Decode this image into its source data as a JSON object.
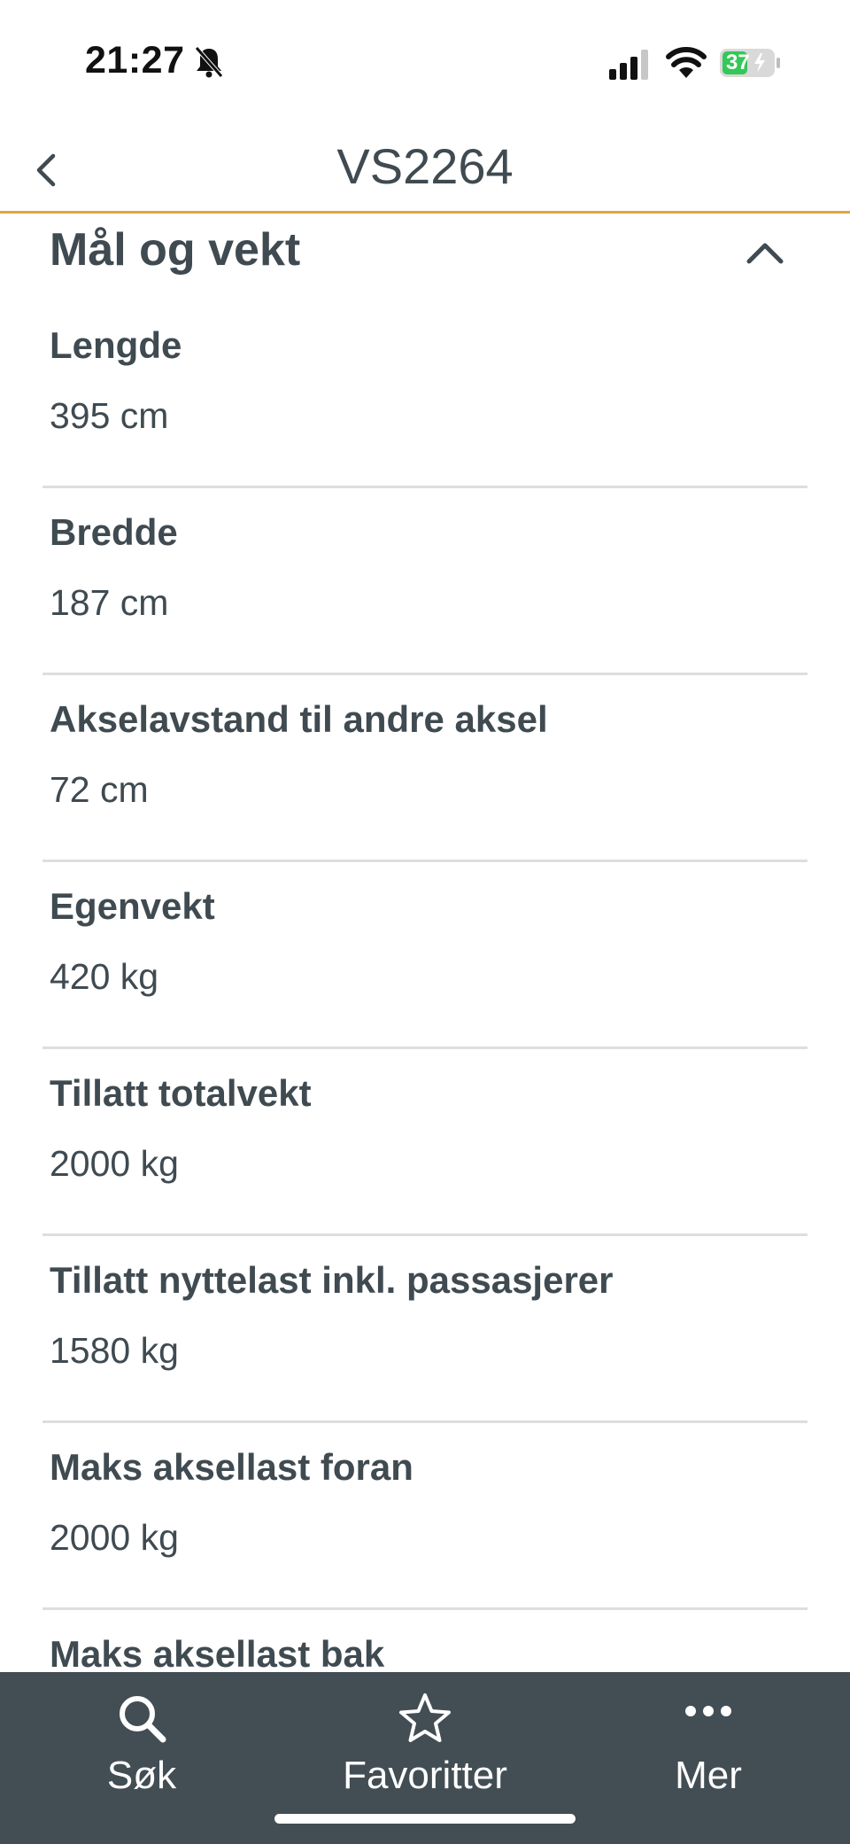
{
  "status_bar": {
    "time": "21:27",
    "battery_level": "37"
  },
  "header": {
    "title": "VS2264",
    "back_icon": "chevron-left-icon"
  },
  "section": {
    "title": "Mål og vekt",
    "toggle_icon": "chevron-up-icon"
  },
  "items": [
    {
      "label": "Lengde",
      "value": "395 cm"
    },
    {
      "label": "Bredde",
      "value": "187 cm"
    },
    {
      "label": "Akselavstand til andre aksel",
      "value": "72 cm"
    },
    {
      "label": "Egenvekt",
      "value": "420 kg"
    },
    {
      "label": "Tillatt totalvekt",
      "value": "2000 kg"
    },
    {
      "label": "Tillatt nyttelast inkl. passasjerer",
      "value": "1580 kg"
    },
    {
      "label": "Maks aksellast foran",
      "value": "2000 kg"
    },
    {
      "label": "Maks aksellast bak",
      "value": ""
    }
  ],
  "tabs": [
    {
      "label": "Søk",
      "icon": "search-icon"
    },
    {
      "label": "Favoritter",
      "icon": "star-icon"
    },
    {
      "label": "Mer",
      "icon": "more-icon"
    }
  ],
  "colors": {
    "accent_rule": "#e0a444",
    "text": "#3f4a51",
    "tab_bar": "#434d54",
    "battery_green": "#34c759"
  }
}
